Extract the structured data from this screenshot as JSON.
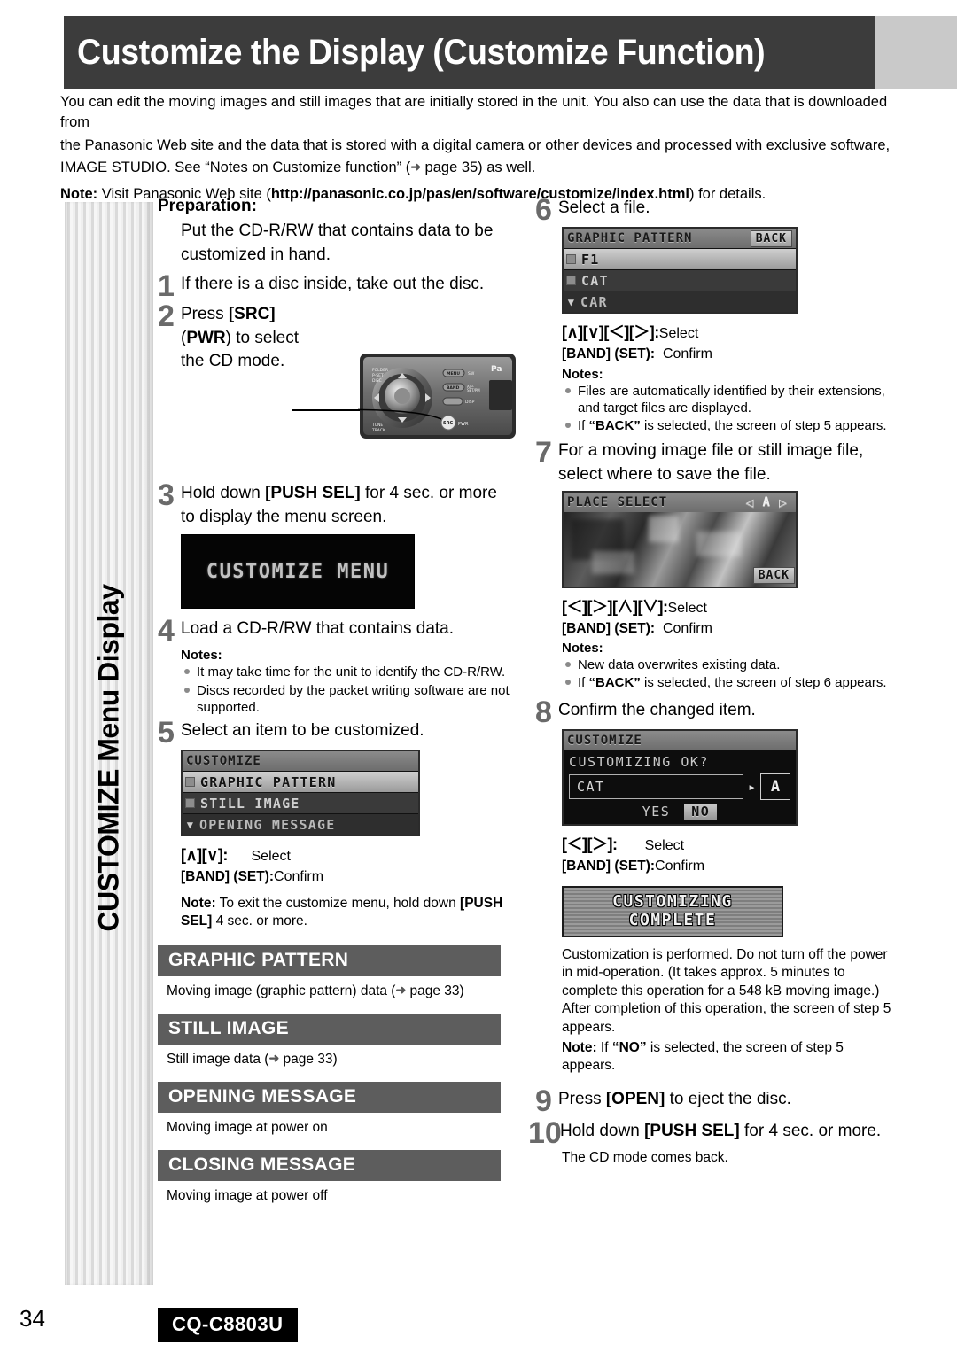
{
  "header": {
    "title": "Customize the Display (Customize Function)"
  },
  "intro": {
    "line1": "You can edit the moving images and still images that are initially stored in the unit. You also can use the data that is downloaded from",
    "line2": "the Panasonic Web site and the data that is stored with a digital camera or other devices and processed with exclusive software,",
    "line3_a": "IMAGE STUDIO. See “Notes on Customize function” (",
    "line3_arrow": "➜",
    "line3_b": " page 35) as well.",
    "note_label": "Note:",
    "note_a": " Visit Panasonic Web site (",
    "note_url": "http://panasonic.co.jp/pas/en/software/customize/index.html",
    "note_b": ") for details."
  },
  "sidebar": {
    "label": "CUSTOMIZE Menu Display"
  },
  "preparation": {
    "heading": "Preparation:",
    "body": "Put the CD-R/RW that contains data to be customized in hand."
  },
  "steps": {
    "s1": {
      "num": "1",
      "text": "If there is a disc inside, take out the disc."
    },
    "s2": {
      "num": "2",
      "t1": "Press ",
      "key1": "[SRC]",
      "t2": "(",
      "key2": "PWR",
      "t3": ") to select",
      "t4": "the CD mode."
    },
    "s3": {
      "num": "3",
      "t1": "Hold down ",
      "key1": "[PUSH SEL]",
      "t2": " for 4 sec. or more to display the menu screen."
    },
    "s4": {
      "num": "4",
      "text": "Load a CD-R/RW that contains data.",
      "notes_label": "Notes:",
      "notes": [
        "It may take time for the unit to identify the CD-R/RW.",
        "Discs recorded by the packet writing software are not supported."
      ]
    },
    "s5": {
      "num": "5",
      "text": "Select an item to be customized.",
      "keys_select_a": "[∧][∨]:",
      "keys_select_b": "Select",
      "keys_confirm_a": "[BAND] (SET):",
      "keys_confirm_b": "Confirm",
      "note_label": "Note:",
      "note_a": " To exit the customize menu, hold down ",
      "note_key": "[PUSH SEL]",
      "note_b": " 4 sec. or more."
    },
    "s6": {
      "num": "6",
      "text": "Select a file.",
      "keys_select_a": "[∧][∨][＜][＞]:",
      "keys_select_b": "Select",
      "keys_confirm_a": "[BAND] (SET):",
      "keys_confirm_b": "Confirm",
      "notes_label": "Notes:",
      "notes_1": "Files are automatically identified by their extensions, and target files are displayed.",
      "notes_2_a": "If ",
      "notes_2_key": "“BACK”",
      "notes_2_b": " is selected, the screen of step 5 appears."
    },
    "s7": {
      "num": "7",
      "text": "For a moving image file or still image file, select where to save the file.",
      "keys_select_a": "[＜][＞][∧][∨]:",
      "keys_select_b": "Select",
      "keys_confirm_a": "[BAND] (SET):",
      "keys_confirm_b": "Confirm",
      "notes_label": "Notes:",
      "notes_1": "New data overwrites existing data.",
      "notes_2_a": "If ",
      "notes_2_key": "“BACK”",
      "notes_2_b": " is selected, the screen of step 6 appears."
    },
    "s8": {
      "num": "8",
      "text": "Confirm the changed item.",
      "keys_select_a": "[＜][＞]:",
      "keys_select_b": "Select",
      "keys_confirm_a": "[BAND] (SET):",
      "keys_confirm_b": "Confirm",
      "body": "Customization is performed. Do not turn off the power in mid-operation. (It takes approx. 5 minutes to complete this operation for a 548 kB moving image.) After completion of this operation, the screen of step 5 appears.",
      "note_label": "Note:",
      "note_a": " If ",
      "note_key": "“NO”",
      "note_b": " is selected, the screen of step 5 appears."
    },
    "s9": {
      "num": "9",
      "t1": "Press ",
      "key1": "[OPEN]",
      "t2": " to eject the disc."
    },
    "s10": {
      "num": "10",
      "t1": "Hold down ",
      "key1": "[PUSH SEL]",
      "t2": " for 4 sec. or more.",
      "after": "The CD mode comes back."
    }
  },
  "lcd": {
    "splash_text": "CUSTOMIZE MENU",
    "customize_menu": {
      "title": "CUSTOMIZE",
      "rows": [
        {
          "label": "GRAPHIC PATTERN",
          "selected": true
        },
        {
          "label": "STILL IMAGE",
          "selected": false
        },
        {
          "label": "OPENING MESSAGE",
          "selected": false
        }
      ]
    },
    "graphic_pattern": {
      "title": "GRAPHIC PATTERN",
      "back": "BACK",
      "rows": [
        {
          "label": "F1",
          "selected": true
        },
        {
          "label": "CAT",
          "selected": false
        },
        {
          "label": "CAR",
          "selected": false
        }
      ]
    },
    "place_select": {
      "title": "PLACE SELECT",
      "left_arrow": "◁",
      "slot": "A",
      "right_arrow": "▷",
      "back": "BACK"
    },
    "confirm_dialog": {
      "title": "CUSTOMIZE",
      "question": "CUSTOMIZING OK?",
      "field_value": "CAT",
      "target": "A",
      "yes": "YES",
      "no": "NO"
    },
    "complete_line1": "CUSTOMIZING",
    "complete_line2": "COMPLETE"
  },
  "sections": [
    {
      "title": "GRAPHIC PATTERN",
      "body_a": "Moving image (graphic pattern) data (",
      "arrow": "➜",
      "body_b": " page 33)"
    },
    {
      "title": "STILL IMAGE",
      "body_a": "Still image data (",
      "arrow": "➜",
      "body_b": " page 33)"
    },
    {
      "title": "OPENING MESSAGE",
      "body_a": "Moving image at power on",
      "arrow": "",
      "body_b": ""
    },
    {
      "title": "CLOSING MESSAGE",
      "body_a": "Moving image at power off",
      "arrow": "",
      "body_b": ""
    }
  ],
  "unit_photo": {
    "labels": {
      "folder": "FOLDER",
      "pset": "P-SET",
      "disc": "DISC",
      "tune": "TUNE",
      "track": "TRACK",
      "menu": "MENU",
      "sw": "SW",
      "band": "BAND",
      "apm": "A/P-SET",
      "disp": "DISP",
      "src": "SRC",
      "pwr": "PWR",
      "brand": "Pa"
    }
  },
  "footer": {
    "page": "34",
    "model": "CQ-C8803U"
  }
}
